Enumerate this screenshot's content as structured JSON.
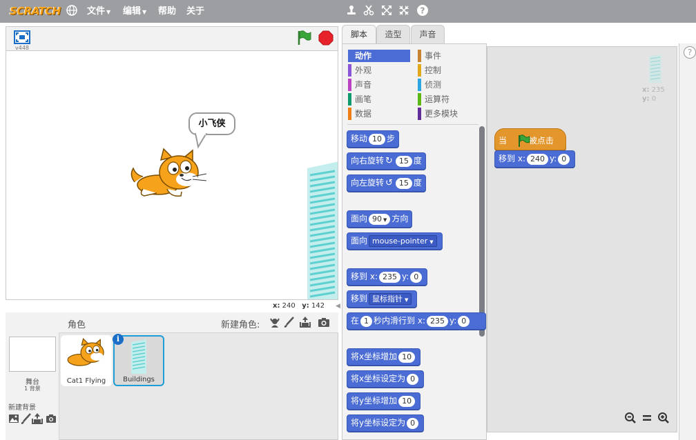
{
  "menubar": {
    "logo": "SCRATCH",
    "items": [
      {
        "label": "文件",
        "has_arrow": true
      },
      {
        "label": "编辑",
        "has_arrow": true
      },
      {
        "label": "帮助",
        "has_arrow": false
      },
      {
        "label": "关于",
        "has_arrow": false
      }
    ]
  },
  "stage": {
    "version": "v448",
    "bubble_text": "小飞侠",
    "coords": {
      "x_label": "x:",
      "x_value": "240",
      "y_label": "y:",
      "y_value": "142"
    }
  },
  "sprites": {
    "title": "角色",
    "new_sprite_label": "新建角色:",
    "stage_label": "舞台",
    "stage_backdrop_count": "1 背景",
    "new_backdrop_label": "新建背景",
    "items": [
      {
        "name": "Cat1 Flying"
      },
      {
        "name": "Buildings"
      }
    ],
    "info_badge": "i"
  },
  "tabs": [
    {
      "label": "脚本",
      "active": true
    },
    {
      "label": "造型",
      "active": false
    },
    {
      "label": "声音",
      "active": false
    }
  ],
  "palette": {
    "categories": [
      {
        "label": "动作",
        "color": "#4a6cd4",
        "active": true
      },
      {
        "label": "事件",
        "color": "#c88330",
        "active": false
      },
      {
        "label": "外观",
        "color": "#8a55d7",
        "active": false
      },
      {
        "label": "控制",
        "color": "#e1a91a",
        "active": false
      },
      {
        "label": "声音",
        "color": "#bb42c3",
        "active": false
      },
      {
        "label": "侦测",
        "color": "#2ca5e2",
        "active": false
      },
      {
        "label": "画笔",
        "color": "#0e9a6c",
        "active": false
      },
      {
        "label": "运算符",
        "color": "#5cb712",
        "active": false
      },
      {
        "label": "数据",
        "color": "#ee7d16",
        "active": false
      },
      {
        "label": "更多模块",
        "color": "#632d99",
        "active": false
      }
    ],
    "blocks": {
      "move": {
        "pre": "移动",
        "value": "10",
        "post": "步"
      },
      "turn_right": {
        "pre": "向右旋转",
        "value": "15",
        "post": "度"
      },
      "turn_left": {
        "pre": "向左旋转",
        "value": "15",
        "post": "度"
      },
      "point_dir": {
        "pre": "面向",
        "value": "90",
        "post": "方向"
      },
      "point_towards": {
        "pre": "面向",
        "value": "mouse-pointer"
      },
      "goto_xy": {
        "pre": "移到",
        "x_label": "x:",
        "x": "235",
        "y_label": "y:",
        "y": "0"
      },
      "goto": {
        "pre": "移到",
        "value": "鼠标指针"
      },
      "glide": {
        "pre": "在",
        "secs": "1",
        "mid": "秒内滑行到",
        "x_label": "x:",
        "x": "235",
        "y_label": "y:",
        "y": "0"
      },
      "change_x": {
        "pre": "将x坐标增加",
        "value": "10"
      },
      "set_x": {
        "pre": "将x坐标设定为",
        "value": "0"
      },
      "change_y": {
        "pre": "将y坐标增加",
        "value": "10"
      },
      "set_y": {
        "pre": "将y坐标设定为",
        "value": "0"
      }
    }
  },
  "script": {
    "hat": {
      "pre": "当",
      "post": "被点击"
    },
    "goto_xy": {
      "pre": "移到",
      "x_label": "x:",
      "x": "240",
      "y_label": "y:",
      "y": "0"
    },
    "coords": {
      "x_label": "x:",
      "x_value": "235",
      "y_label": "y:",
      "y_value": "0"
    },
    "zoom": {
      "out": "−",
      "reset": "=",
      "in": "+"
    },
    "help": "?"
  },
  "colors": {
    "menubar": "#9c9ea2",
    "motion": "#4a6cd4",
    "events": "#e2962b",
    "green_flag": "#3aa53a",
    "stop": "#e8222a",
    "selection": "#1b9ed8"
  }
}
